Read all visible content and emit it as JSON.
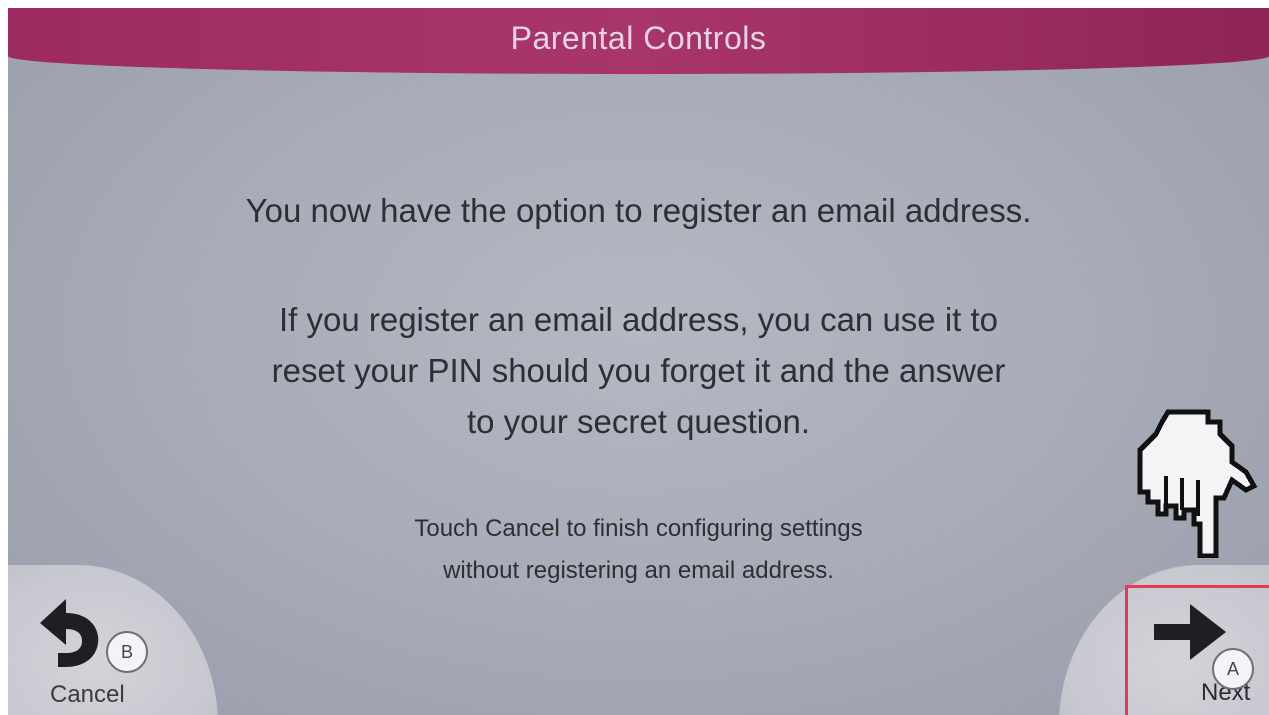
{
  "header": {
    "title": "Parental Controls"
  },
  "message": {
    "main": "You now have the option to register an email address.",
    "body_lines": [
      "If you register an email address, you can use it to",
      "reset your PIN should you forget it and the answer",
      "to your secret question."
    ],
    "note_lines": [
      "Touch Cancel to finish configuring settings",
      "without registering an email address."
    ]
  },
  "footer": {
    "cancel": {
      "label": "Cancel",
      "key": "B",
      "icon": "back-arrow-icon"
    },
    "next": {
      "label": "Next",
      "key": "A",
      "icon": "right-arrow-icon"
    }
  },
  "overlay": {
    "pointer_icon": "pointing-hand-icon",
    "highlight_color": "#e8355a"
  },
  "colors": {
    "title_bar": "#a8356c",
    "background": "#a9adb9",
    "text": "#2e2f34"
  }
}
